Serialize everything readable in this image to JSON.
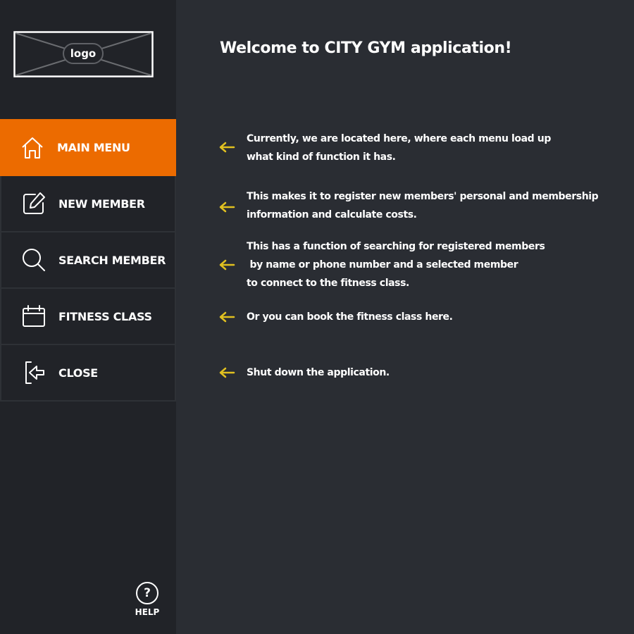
{
  "sidebar": {
    "logo_text": "logo",
    "menu": [
      {
        "label": "MAIN MENU",
        "icon": "home-icon",
        "active": true
      },
      {
        "label": "NEW MEMBER",
        "icon": "edit-icon",
        "active": false
      },
      {
        "label": "SEARCH MEMBER",
        "icon": "search-icon",
        "active": false
      },
      {
        "label": "FITNESS CLASS",
        "icon": "calendar-icon",
        "active": false
      },
      {
        "label": "CLOSE",
        "icon": "exit-icon",
        "active": false
      }
    ],
    "help_label": "HELP",
    "help_symbol": "?"
  },
  "main": {
    "title": "Welcome to CITY GYM application!",
    "descriptions": [
      "Currently, we are located here, where each menu load up\nwhat kind of function it has.",
      "This makes it to register new members' personal and membership\ninformation and calculate costs.",
      "This has a function of searching for registered members\n by name or phone number and a selected member\nto connect to the fitness class.",
      "Or you can book the fitness class here.",
      "Shut down the application."
    ]
  },
  "colors": {
    "accent": "#ec6b00",
    "arrow": "#e0c020",
    "sidebar_bg": "#212328",
    "main_bg": "#2a2d33"
  }
}
